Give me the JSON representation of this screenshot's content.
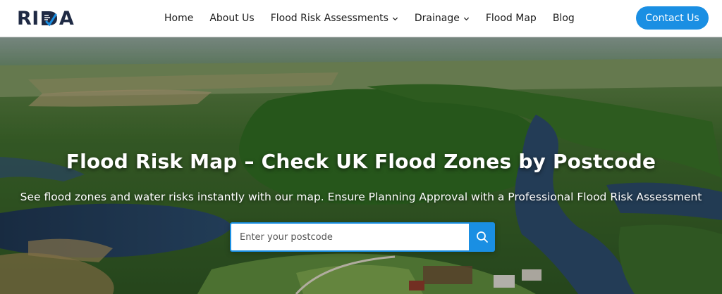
{
  "brand": {
    "logo_text_left": "RI",
    "logo_text_right": "A",
    "logo_color": "#1f2a44",
    "logo_accent": "#1a8fe3"
  },
  "nav": {
    "items": [
      {
        "label": "Home",
        "has_dropdown": false
      },
      {
        "label": "About Us",
        "has_dropdown": false
      },
      {
        "label": "Flood Risk Assessments",
        "has_dropdown": true
      },
      {
        "label": "Drainage",
        "has_dropdown": true
      },
      {
        "label": "Flood Map",
        "has_dropdown": false
      },
      {
        "label": "Blog",
        "has_dropdown": false
      }
    ],
    "contact_label": "Contact Us"
  },
  "hero": {
    "title": "Flood Risk Map – Check UK Flood Zones by Postcode",
    "subtitle": "See flood zones and water risks instantly with our map. Ensure Planning Approval with a Professional Flood Risk Assessment",
    "search": {
      "placeholder": "Enter your postcode",
      "value": "",
      "button_icon": "search-icon"
    }
  },
  "colors": {
    "accent": "#1a8fe3",
    "header_bg": "#ffffff",
    "nav_text": "#1c1c1c"
  }
}
